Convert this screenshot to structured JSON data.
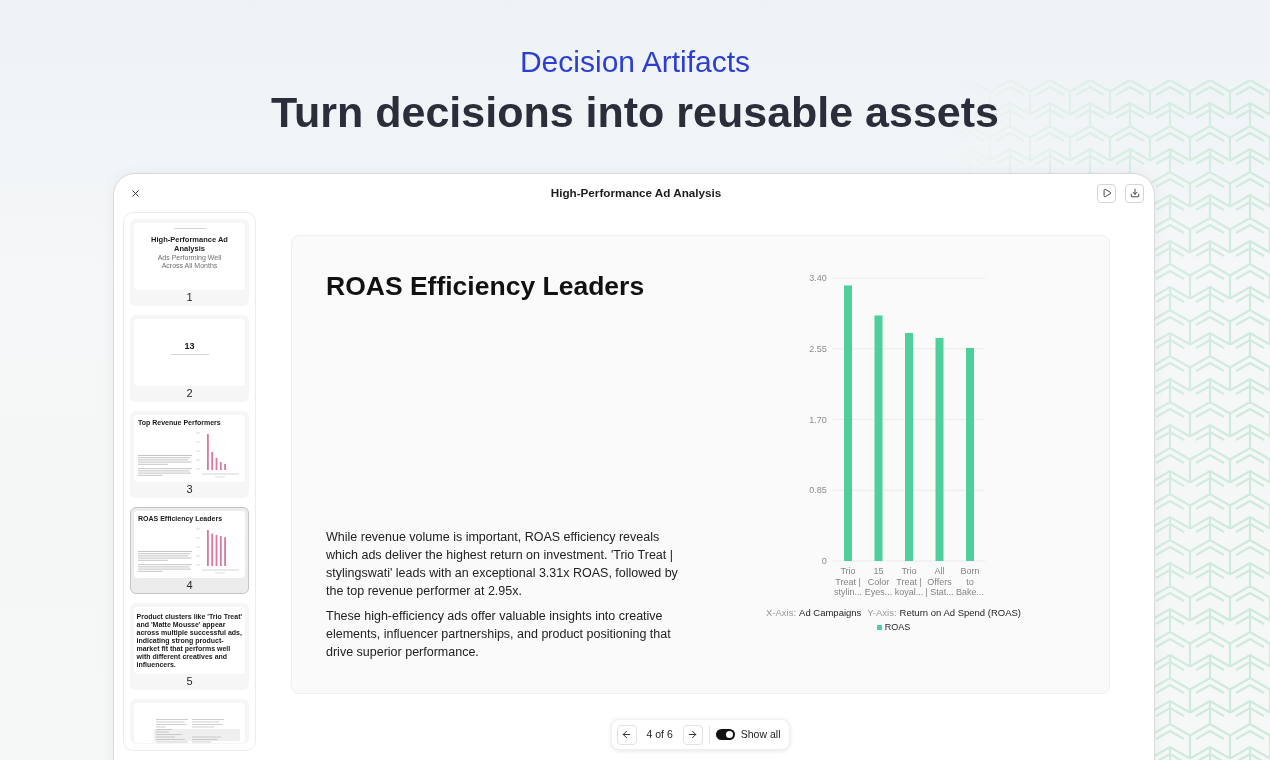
{
  "hero": {
    "eyebrow": "Decision Artifacts",
    "headline": "Turn decisions into reusable assets"
  },
  "window": {
    "title": "High-Performance Ad Analysis"
  },
  "thumbnails": [
    {
      "kind": "title",
      "number": "1",
      "selected": false,
      "title": "High-Performance Ad Analysis",
      "subtitle": "Ads Performing Well Across All Months"
    },
    {
      "kind": "stat",
      "number": "2",
      "selected": false,
      "value": "13"
    },
    {
      "kind": "chart",
      "number": "3",
      "selected": false,
      "title": "Top Revenue Performers"
    },
    {
      "kind": "chart",
      "number": "4",
      "selected": true,
      "title": "ROAS Efficiency Leaders"
    },
    {
      "kind": "text",
      "number": "5",
      "selected": false,
      "text": "Product clusters like 'Trio Treat' and 'Matte Mousse' appear across multiple successful ads, indicating strong product-market fit that performs well with different creatives and influencers."
    },
    {
      "kind": "columns",
      "selected": false
    }
  ],
  "slide": {
    "title": "ROAS Efficiency Leaders",
    "paragraphs": [
      "While revenue volume is important, ROAS efficiency reveals which ads deliver the highest return on investment. 'Trio Treat | stylingswati' leads with an exceptional 3.31x ROAS, followed by the top revenue performer at 2.95x.",
      "These high-efficiency ads offer valuable insights into creative elements, influencer partnerships, and product positioning that drive superior performance."
    ],
    "chart_data": {
      "type": "bar",
      "grid": true,
      "categories": [
        "Trio Treat | stylin...",
        "15 Color Eyes...",
        "Trio Treat | koyal...",
        "All Offers | Stat...",
        "Born to Bake..."
      ],
      "series": [
        {
          "name": "ROAS",
          "color": "#4ecf9b",
          "values": [
            3.31,
            2.95,
            2.74,
            2.68,
            2.56
          ]
        }
      ],
      "ylim": [
        0,
        3.4
      ],
      "yticks": [
        0,
        0.85,
        {
          "value": 1.7,
          "label": "1.70"
        },
        2.55,
        {
          "value": 3.4,
          "label": "3.40"
        }
      ]
    },
    "axis_captions": [
      {
        "tag": "X-Axis:",
        "title": "Ad Campaigns"
      },
      {
        "tag": "Y-Axis:",
        "title": "Return on Ad Spend (ROAS)"
      }
    ]
  },
  "pager": {
    "page_label": "4 of 6",
    "show_all": {
      "label": "Show all",
      "on": true
    }
  }
}
